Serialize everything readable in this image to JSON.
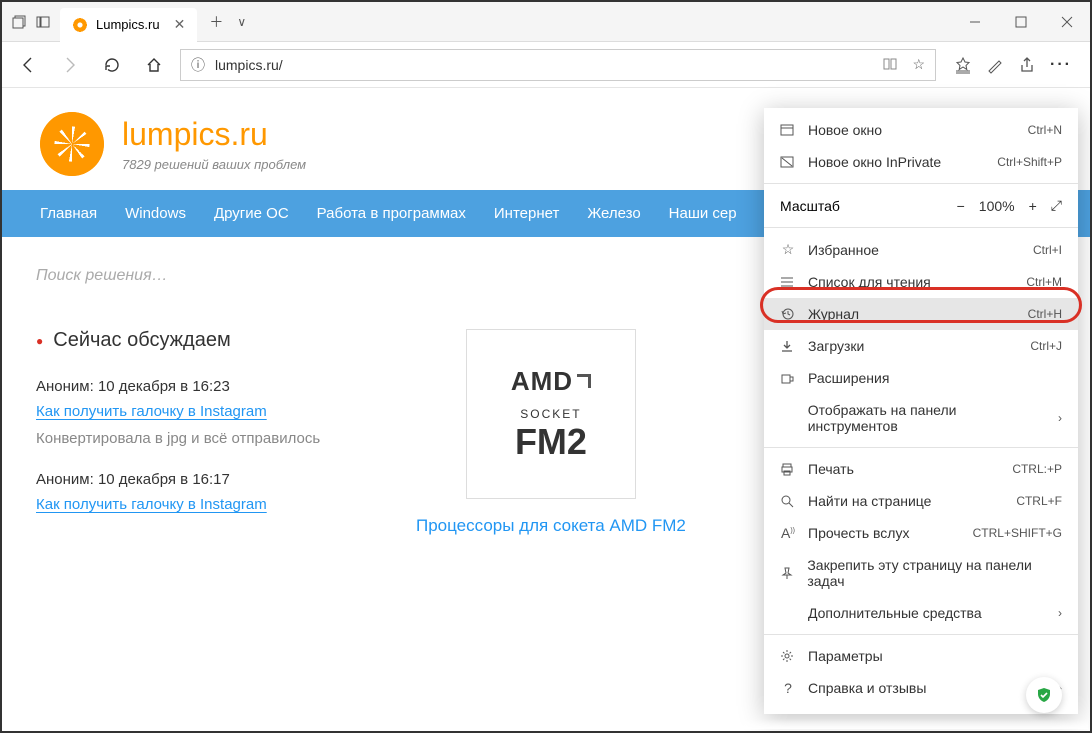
{
  "tab": {
    "title": "Lumpics.ru"
  },
  "url": "lumpics.ru/",
  "site": {
    "name": "lumpics.ru",
    "tagline": "7829 решений ваших проблем"
  },
  "nav": [
    "Главная",
    "Windows",
    "Другие ОС",
    "Работа в программах",
    "Интернет",
    "Железо",
    "Наши сер"
  ],
  "search_placeholder": "Поиск решения…",
  "widget_title": "Сейчас обсуждаем",
  "comments": [
    {
      "meta": "Аноним: 10 декабря в 16:23",
      "link": "Как получить галочку в Instagram",
      "body": "Конвертировала в jpg и всё отправилось"
    },
    {
      "meta": "Аноним: 10 декабря в 16:17",
      "link": "Как получить галочку в Instagram",
      "body": ""
    }
  ],
  "article": {
    "amd": {
      "brand": "AMD",
      "socket": "SOCKET",
      "model": "FM2"
    },
    "link": "Процессоры для сокета AMD FM2"
  },
  "menu": {
    "new_window": {
      "label": "Новое окно",
      "sc": "Ctrl+N"
    },
    "new_inprivate": {
      "label": "Новое окно InPrivate",
      "sc": "Ctrl+Shift+P"
    },
    "zoom_label": "Масштаб",
    "zoom_value": "100%",
    "favorites": {
      "label": "Избранное",
      "sc": "Ctrl+I"
    },
    "reading_list": {
      "label": "Список для чтения",
      "sc": "Ctrl+M"
    },
    "history": {
      "label": "Журнал",
      "sc": "Ctrl+H"
    },
    "downloads": {
      "label": "Загрузки",
      "sc": "Ctrl+J"
    },
    "extensions": {
      "label": "Расширения"
    },
    "show_toolbar": {
      "label": "Отображать на панели инструментов"
    },
    "print": {
      "label": "Печать",
      "sc": "CTRL:+P"
    },
    "find": {
      "label": "Найти на странице",
      "sc": "CTRL+F"
    },
    "read_aloud": {
      "label": "Прочесть вслух",
      "sc": "CTRL+SHIFT+G"
    },
    "pin": {
      "label": "Закрепить эту страницу на панели задач"
    },
    "more_tools": {
      "label": "Дополнительные средства"
    },
    "settings": {
      "label": "Параметры"
    },
    "help": {
      "label": "Справка и отзывы"
    }
  }
}
